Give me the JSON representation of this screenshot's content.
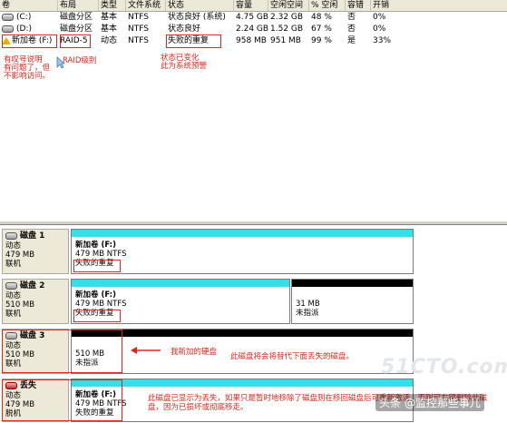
{
  "columns": [
    "卷",
    "布局",
    "类型",
    "文件系统",
    "状态",
    "容量",
    "空闲空间",
    "% 空闲",
    "容错",
    "开销"
  ],
  "volumes": [
    {
      "name": "(C:)",
      "layout": "磁盘分区",
      "type": "基本",
      "fs": "NTFS",
      "status": "状态良好 (系统)",
      "capacity": "4.75 GB",
      "free": "2.32 GB",
      "pct_free": "48 %",
      "fault": "否",
      "overhead": "0%"
    },
    {
      "name": "(D:)",
      "layout": "磁盘分区",
      "type": "基本",
      "fs": "NTFS",
      "status": "状态良好",
      "capacity": "2.24 GB",
      "free": "1.52 GB",
      "pct_free": "67 %",
      "fault": "否",
      "overhead": "0%"
    },
    {
      "name": "新加卷 (F:)",
      "layout": "RAID-5",
      "type": "动态",
      "fs": "NTFS",
      "status": "失败的重复",
      "capacity": "958 MB",
      "free": "951 MB",
      "pct_free": "99 %",
      "fault": "是",
      "overhead": "33%"
    }
  ],
  "annotations": {
    "warn_note": "有叹号说明\n有问题了，但\n不影响访问。",
    "raid_note": "RAID级别",
    "status_note": "状态已变化\n此为系统预警",
    "new_disk_note": "我新加的硬盘",
    "replace_note": "此磁盘将会将替代下面丢失的磁盘。",
    "missing_note": "此磁盘已显示为丢失，如果只是暂时地移除了磁盘则在移回磁盘后可重新激活，否则可右键删除此磁盘，因为已损坏或彻底移走。"
  },
  "disks": [
    {
      "title": "磁盘 1",
      "type": "动态",
      "size": "479 MB",
      "state": "联机",
      "partitions": [
        {
          "name": "新加卷 (F:)",
          "detail": "479 MB NTFS",
          "status": "失败的重复"
        }
      ]
    },
    {
      "title": "磁盘 2",
      "type": "动态",
      "size": "510 MB",
      "state": "联机",
      "partitions": [
        {
          "name": "新加卷 (F:)",
          "detail": "479 MB NTFS",
          "status": "失败的重复"
        },
        {
          "name": "",
          "detail": "31 MB",
          "status": "未指派"
        }
      ]
    },
    {
      "title": "磁盘 3",
      "type": "动态",
      "size": "510 MB",
      "state": "联机",
      "partitions": [
        {
          "name": "",
          "detail": "510 MB",
          "status": "未指派"
        }
      ]
    },
    {
      "title": "丢失",
      "type": "动态",
      "size": "479 MB",
      "state": "脱机",
      "partitions": [
        {
          "name": "新加卷 (F:)",
          "detail": "479 MB NTFS",
          "status": "失败的重复"
        }
      ]
    }
  ],
  "watermark": "51CTO.com",
  "brand": "头条 @监控那些事儿",
  "colors": {
    "raid_bar": "#33e0e8",
    "unallocated_bar": "#000000",
    "annotation": "#e0261a"
  }
}
